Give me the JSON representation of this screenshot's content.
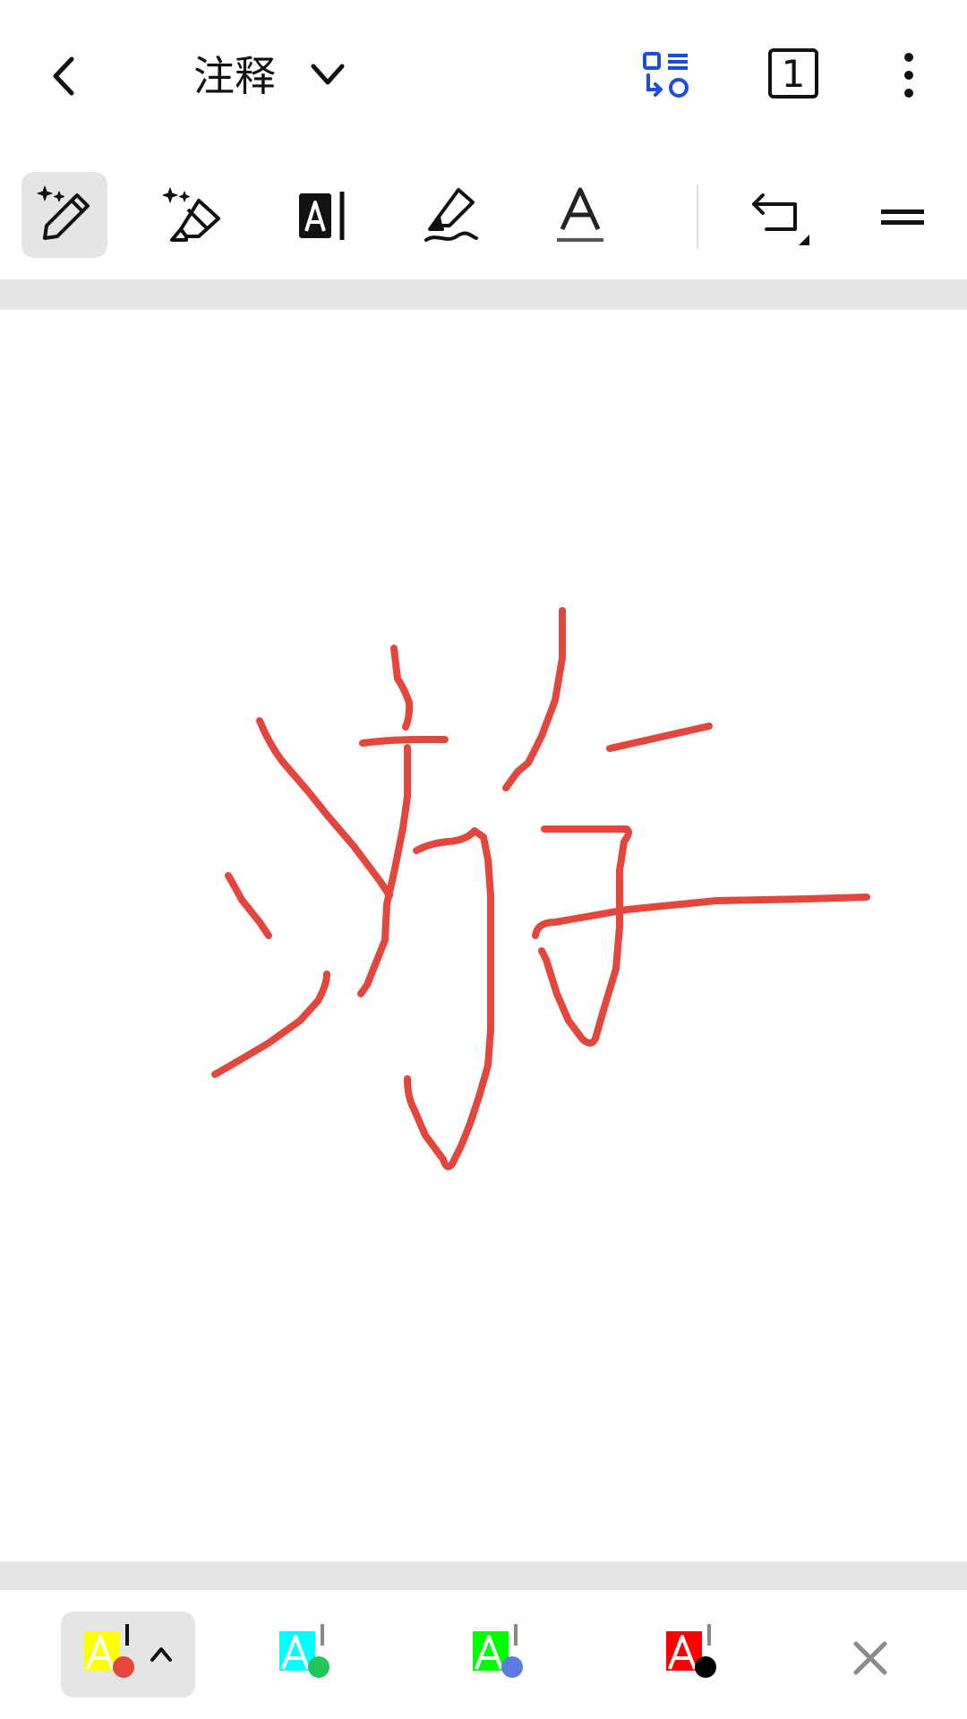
{
  "header": {
    "title": "注释",
    "page_count": "1"
  },
  "colors": {
    "accent_blue": "#1c4fd6",
    "ink_red": "#e2463c",
    "separator_gray": "#e6e6e6",
    "selected_bg": "#e5e5e5"
  },
  "toolbar": {
    "tools": [
      {
        "name": "smart-pen",
        "selected": true
      },
      {
        "name": "smart-highlighter",
        "selected": false
      },
      {
        "name": "text-box",
        "selected": false
      },
      {
        "name": "highlighter",
        "selected": false
      },
      {
        "name": "text-underline",
        "selected": false
      },
      {
        "name": "undo",
        "selected": false
      },
      {
        "name": "menu",
        "selected": false
      }
    ]
  },
  "bottom": {
    "swatches": [
      {
        "highlight": "#ffff00",
        "dot": "#e2463c",
        "selected": true
      },
      {
        "highlight": "#00ffff",
        "dot": "#22c55e",
        "selected": false
      },
      {
        "highlight": "#00ff00",
        "dot": "#5b7be0",
        "selected": false
      },
      {
        "highlight": "#ff0000",
        "dot": "#000000",
        "selected": false
      }
    ]
  }
}
